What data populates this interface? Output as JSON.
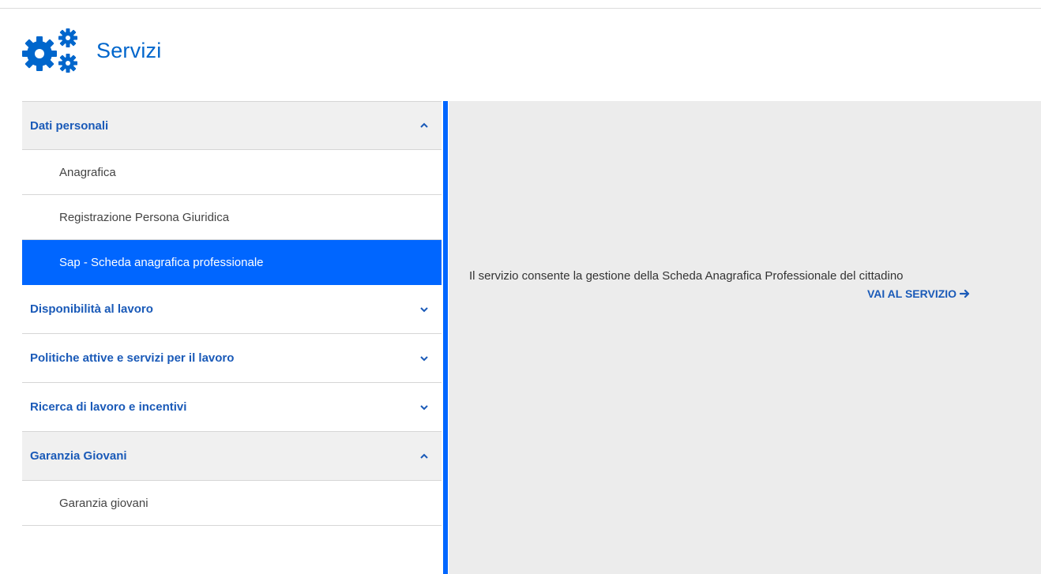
{
  "header": {
    "title": "Servizi",
    "icon": "gears-icon"
  },
  "menu": {
    "sections": [
      {
        "label": "Dati personali",
        "expanded": true,
        "items": [
          {
            "label": "Anagrafica",
            "active": false
          },
          {
            "label": "Registrazione Persona Giuridica",
            "active": false
          },
          {
            "label": "Sap - Scheda anagrafica professionale",
            "active": true
          }
        ]
      },
      {
        "label": "Disponibilità al lavoro",
        "expanded": false,
        "items": []
      },
      {
        "label": "Politiche attive e servizi per il lavoro",
        "expanded": false,
        "items": []
      },
      {
        "label": "Ricerca di lavoro e incentivi",
        "expanded": false,
        "items": []
      },
      {
        "label": "Garanzia Giovani",
        "expanded": true,
        "items": [
          {
            "label": "Garanzia giovani",
            "active": false
          }
        ]
      }
    ]
  },
  "detail": {
    "description": "Il servizio consente la gestione della Scheda Anagrafica Professionale del cittadino",
    "cta_label": "VAI AL SERVIZIO"
  },
  "colors": {
    "accent": "#0066ff",
    "link": "#1a5ab8",
    "title": "#0066cc",
    "panel_bg": "#ececec",
    "section_open_bg": "#f0f0f0"
  }
}
